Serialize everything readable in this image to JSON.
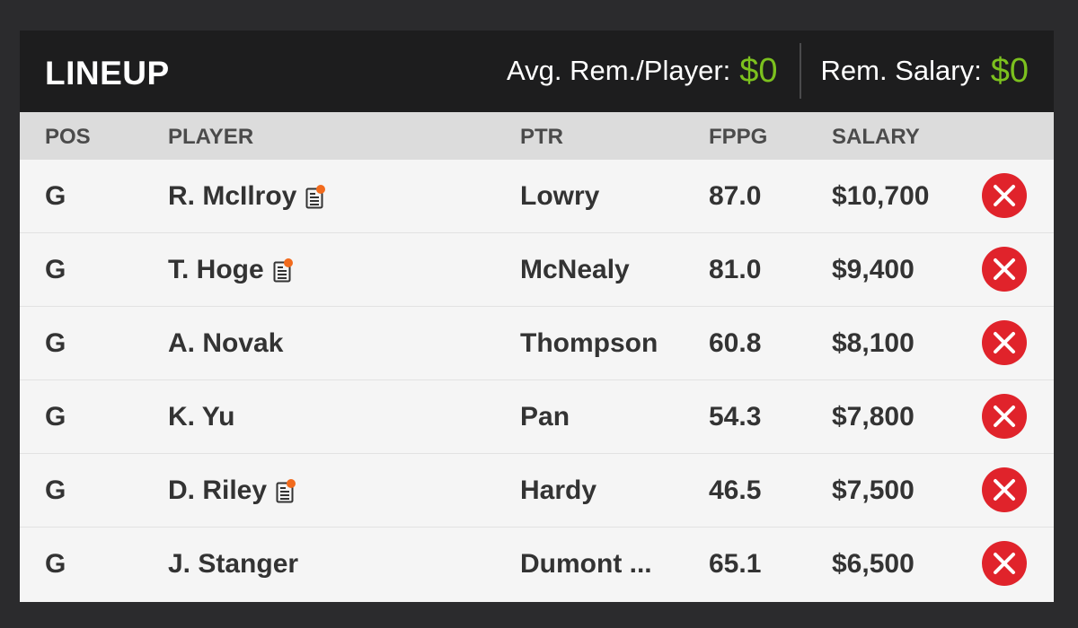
{
  "header": {
    "title": "LINEUP",
    "avg_label": "Avg. Rem./Player:",
    "avg_value": "$0",
    "rem_label": "Rem. Salary:",
    "rem_value": "$0"
  },
  "columns": {
    "pos": "POS",
    "player": "PLAYER",
    "ptr": "PTR",
    "fppg": "FPPG",
    "salary": "SALARY"
  },
  "rows": [
    {
      "pos": "G",
      "player": "R. McIlroy",
      "has_news": true,
      "ptr": "Lowry",
      "fppg": "87.0",
      "salary": "$10,700"
    },
    {
      "pos": "G",
      "player": "T. Hoge",
      "has_news": true,
      "ptr": "McNealy",
      "fppg": "81.0",
      "salary": "$9,400"
    },
    {
      "pos": "G",
      "player": "A. Novak",
      "has_news": false,
      "ptr": "Thompson",
      "fppg": "60.8",
      "salary": "$8,100"
    },
    {
      "pos": "G",
      "player": "K. Yu",
      "has_news": false,
      "ptr": "Pan",
      "fppg": "54.3",
      "salary": "$7,800"
    },
    {
      "pos": "G",
      "player": "D. Riley",
      "has_news": true,
      "ptr": "Hardy",
      "fppg": "46.5",
      "salary": "$7,500"
    },
    {
      "pos": "G",
      "player": "J. Stanger",
      "has_news": false,
      "ptr": "Dumont ...",
      "fppg": "65.1",
      "salary": "$6,500"
    }
  ],
  "icons": {
    "news": "player-news-icon",
    "remove": "remove-player-icon"
  },
  "colors": {
    "accent_green": "#7cc11e",
    "remove_red": "#e0232b",
    "news_dot": "#f26b1d"
  }
}
